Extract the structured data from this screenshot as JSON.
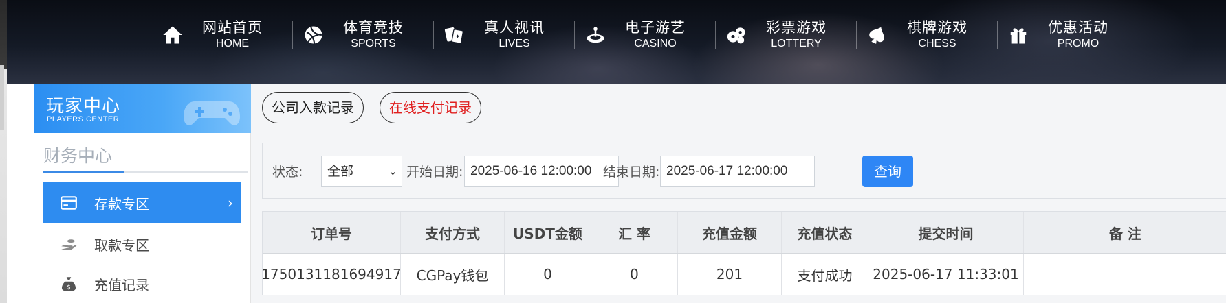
{
  "nav": {
    "items": [
      {
        "cn": "网站首页",
        "en": "HOME",
        "icon": "home-icon"
      },
      {
        "cn": "体育竞技",
        "en": "SPORTS",
        "icon": "ball-icon"
      },
      {
        "cn": "真人视讯",
        "en": "LIVES",
        "icon": "cards-icon"
      },
      {
        "cn": "电子游艺",
        "en": "CASINO",
        "icon": "roulette-icon"
      },
      {
        "cn": "彩票游戏",
        "en": "LOTTERY",
        "icon": "lottery-balls-icon"
      },
      {
        "cn": "棋牌游戏",
        "en": "CHESS",
        "icon": "spade-icon"
      },
      {
        "cn": "优惠活动",
        "en": "PROMO",
        "icon": "gift-icon"
      }
    ]
  },
  "sidebar": {
    "header_title": "玩家中心",
    "header_sub": "PLAYERS CENTER",
    "section_title": "财务中心",
    "items": [
      {
        "label": "存款专区",
        "icon": "card-icon",
        "active": true
      },
      {
        "label": "取款专区",
        "icon": "hand-coin-icon",
        "active": false
      },
      {
        "label": "充值记录",
        "icon": "money-bag-icon",
        "active": false
      }
    ]
  },
  "tabs": {
    "company_deposit": "公司入款记录",
    "online_payment": "在线支付记录"
  },
  "filter": {
    "status_label": "状态:",
    "status_value": "全部",
    "start_label": "开始日期:",
    "start_value": "2025-06-16 12:00:00",
    "end_label": "结束日期:",
    "end_value": "2025-06-17 12:00:00",
    "query_button": "查询"
  },
  "table": {
    "headers": [
      "订单号",
      "支付方式",
      "USDT金额",
      "汇 率",
      "充值金额",
      "充值状态",
      "提交时间",
      "备 注"
    ],
    "rows": [
      [
        "1750131181694917",
        "CGPay钱包",
        "0",
        "0",
        "201",
        "支付成功",
        "2025-06-17 11:33:01",
        ""
      ]
    ]
  },
  "colors": {
    "accent": "#2e8cf0",
    "active_tab_text": "#e02020",
    "nav_bg": "#0f131c"
  }
}
